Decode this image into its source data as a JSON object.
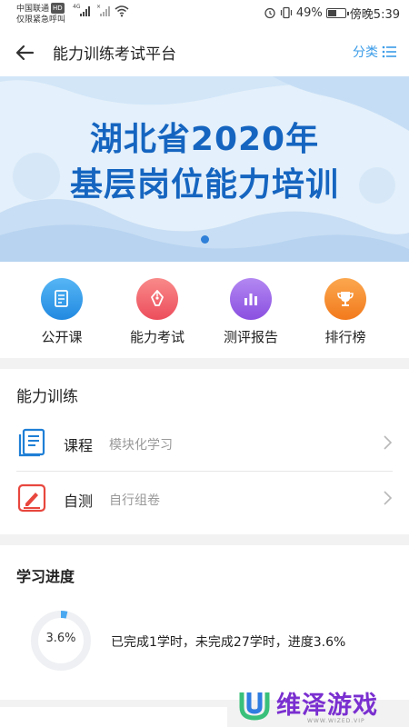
{
  "status_bar": {
    "carrier": "中国联通",
    "hd_badge": "HD",
    "emergency": "仅限紧急呼叫",
    "signal_tag_1": "4G",
    "signal_tag_2": "×",
    "battery_percent": "49%",
    "battery_level": 0.49,
    "time": "傍晚5:39"
  },
  "header": {
    "title": "能力训练考试平台",
    "category_label": "分类",
    "back_icon": "arrow-left-icon",
    "category_icon": "list-icon"
  },
  "banner": {
    "line1": "湖北省2020年",
    "line2": "基层岗位能力培训",
    "slide_count": 1,
    "active_slide": 1
  },
  "quick_nav": [
    {
      "label": "公开课",
      "icon": "document-icon",
      "color": "#2f9ce9"
    },
    {
      "label": "能力考试",
      "icon": "pen-icon",
      "color": "#f26b6b"
    },
    {
      "label": "测评报告",
      "icon": "bar-chart-icon",
      "color": "#9b5de5"
    },
    {
      "label": "排行榜",
      "icon": "trophy-icon",
      "color": "#f5892b"
    }
  ],
  "training": {
    "title": "能力训练",
    "items": [
      {
        "name": "课程",
        "desc": "模块化学习",
        "icon": "course-book-icon"
      },
      {
        "name": "自测",
        "desc": "自行组卷",
        "icon": "self-test-icon"
      }
    ]
  },
  "progress": {
    "title": "学习进度",
    "percent_label": "3.6%",
    "percent_value": 3.6,
    "summary": "已完成1学时，未完成27学时，进度3.6%"
  },
  "watermark": {
    "text": "维泽游戏",
    "sub": "WWW.WIZED.VIP"
  },
  "colors": {
    "accent": "#3b9ce8",
    "banner_text": "#1565c0",
    "progress_ring": "#4aa8f0",
    "watermark": "#7a2fd0"
  }
}
